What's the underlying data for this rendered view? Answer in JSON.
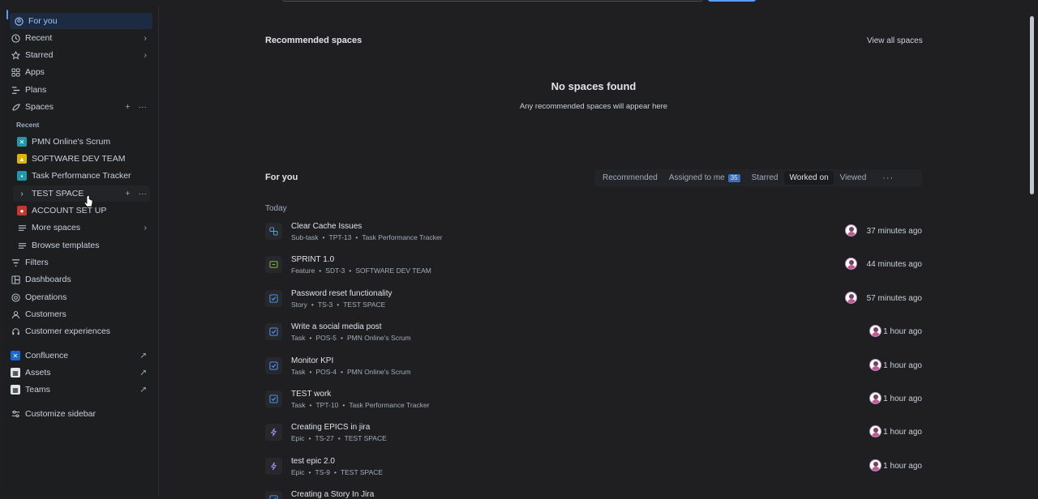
{
  "sidebar": {
    "for_you": "For you",
    "recent": "Recent",
    "starred": "Starred",
    "apps": "Apps",
    "plans": "Plans",
    "spaces": "Spaces",
    "recent_section": "Recent",
    "space_items": [
      {
        "label": "PMN Online's Scrum",
        "color": "#1d9aaa"
      },
      {
        "label": "SOFTWARE DEV TEAM",
        "color": "#e2b203"
      },
      {
        "label": "Task Performance Tracker",
        "color": "#1d9aaa"
      },
      {
        "label": "TEST SPACE",
        "color": ""
      },
      {
        "label": "ACCOUNT SET UP",
        "color": "#c9372c"
      }
    ],
    "more_spaces": "More spaces",
    "browse_templates": "Browse templates",
    "filters": "Filters",
    "dashboards": "Dashboards",
    "operations": "Operations",
    "customers": "Customers",
    "customer_experiences": "Customer experiences",
    "confluence": "Confluence",
    "assets": "Assets",
    "teams": "Teams",
    "customize": "Customize sidebar"
  },
  "recommended": {
    "title": "Recommended spaces",
    "view_all": "View all spaces",
    "empty_title": "No spaces found",
    "empty_sub": "Any recommended spaces will appear here"
  },
  "for_you": {
    "title": "For you",
    "tabs": {
      "recommended": "Recommended",
      "assigned": "Assigned to me",
      "assigned_count": "35",
      "starred": "Starred",
      "worked_on": "Worked on",
      "viewed": "Viewed"
    },
    "group": "Today",
    "items": [
      {
        "title": "Clear Cache Issues",
        "type": "Sub-task",
        "key": "TPT-13",
        "space": "Task Performance Tracker",
        "time": "37 minutes ago",
        "icon": "subtask-icon"
      },
      {
        "title": "SPRINT 1.0",
        "type": "Feature",
        "key": "SDT-3",
        "space": "SOFTWARE DEV TEAM",
        "time": "44 minutes ago",
        "icon": "feature-icon"
      },
      {
        "title": "Password reset functionality",
        "type": "Story",
        "key": "TS-3",
        "space": "TEST SPACE",
        "time": "57 minutes ago",
        "icon": "task-icon"
      },
      {
        "title": "Write a social media post",
        "type": "Task",
        "key": "POS-5",
        "space": "PMN Online's Scrum",
        "time": "1 hour ago",
        "icon": "task-icon"
      },
      {
        "title": "Monitor KPI",
        "type": "Task",
        "key": "POS-4",
        "space": "PMN Online's Scrum",
        "time": "1 hour ago",
        "icon": "task-icon"
      },
      {
        "title": "TEST work",
        "type": "Task",
        "key": "TPT-10",
        "space": "Task Performance Tracker",
        "time": "1 hour ago",
        "icon": "task-icon"
      },
      {
        "title": "Creating EPICS in jira",
        "type": "Epic",
        "key": "TS-27",
        "space": "TEST SPACE",
        "time": "1 hour ago",
        "icon": "epic-icon"
      },
      {
        "title": "test epic 2.0",
        "type": "Epic",
        "key": "TS-9",
        "space": "TEST SPACE",
        "time": "1 hour ago",
        "icon": "epic-icon"
      },
      {
        "title": "Creating a Story In Jira",
        "type": "",
        "key": "",
        "space": "",
        "time": "",
        "icon": "task-icon"
      }
    ]
  }
}
